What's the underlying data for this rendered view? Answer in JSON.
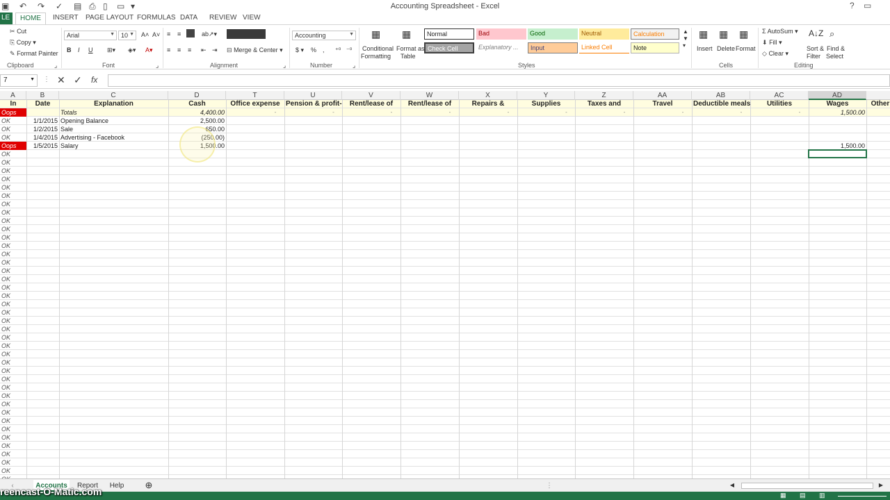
{
  "window": {
    "title": "Accounting Spreadsheet - Excel",
    "help": "?",
    "restore": "▭"
  },
  "tabs": {
    "file": "LE",
    "home": "HOME",
    "insert": "INSERT",
    "page_layout": "PAGE LAYOUT",
    "formulas": "FORMULAS",
    "data": "DATA",
    "review": "REVIEW",
    "view": "VIEW"
  },
  "ribbon": {
    "clipboard": {
      "label": "Clipboard",
      "cut": "Cut",
      "copy": "Copy",
      "format_painter": "Format Painter"
    },
    "font": {
      "label": "Font",
      "name": "Arial",
      "size": "10",
      "bold": "B",
      "italic": "I",
      "underline": "U"
    },
    "alignment": {
      "label": "Alignment",
      "merge": "Merge & Center"
    },
    "number": {
      "label": "Number",
      "format": "Accounting",
      "currency": "$",
      "percent": "%",
      "comma": ","
    },
    "styles": {
      "label": "Styles",
      "conditional": "Conditional",
      "formatting": "Formatting",
      "format_as": "Format as",
      "table": "Table",
      "cells": [
        [
          "Normal",
          "Bad",
          "Good",
          "Neutral",
          "Calculation"
        ],
        [
          "Check Cell",
          "Explanatory ...",
          "Input",
          "Linked Cell",
          "Note"
        ]
      ]
    },
    "cells": {
      "label": "Cells",
      "insert": "Insert",
      "delete": "Delete",
      "format": "Format"
    },
    "editing": {
      "label": "Editing",
      "autosum": "AutoSum",
      "fill": "Fill",
      "clear": "Clear",
      "sort": "Sort &",
      "filter": "Filter",
      "find": "Find &",
      "select": "Select"
    }
  },
  "formula_bar": {
    "name_box": "7",
    "fx": "fx"
  },
  "columns": [
    "A",
    "B",
    "C",
    "D",
    "T",
    "U",
    "V",
    "W",
    "X",
    "Y",
    "Z",
    "AA",
    "AB",
    "AC",
    "AD"
  ],
  "headers": {
    "a": "In",
    "b": "Date",
    "c": "Explanation",
    "d": "Cash",
    "t": "Office expense",
    "u": "Pension & profit-",
    "v": "Rent/lease of",
    "w": "Rent/lease of",
    "x": "Repairs &",
    "y": "Supplies",
    "z": "Taxes and",
    "aa": "Travel",
    "ab": "Deductible meals",
    "ac": "Utilities",
    "ad": "Wages",
    "other": "Other"
  },
  "totals": {
    "status": "Oops",
    "label": "Totals",
    "cash": "4,400.00",
    "wages": "1,500.00",
    "dash": "-"
  },
  "rows": [
    {
      "status": "OK",
      "date": "1/1/2015",
      "explanation": "Opening Balance",
      "cash": "2,500.00",
      "wages": ""
    },
    {
      "status": "OK",
      "date": "1/2/2015",
      "explanation": "Sale",
      "cash": "650.00",
      "wages": ""
    },
    {
      "status": "OK",
      "date": "1/4/2015",
      "explanation": "Advertising - Facebook",
      "cash": "(250.00)",
      "wages": ""
    },
    {
      "status": "Oops",
      "date": "1/5/2015",
      "explanation": "Salary",
      "cash": "1,500.00",
      "wages": "1,500.00"
    }
  ],
  "ok_label": "OK",
  "sheets": {
    "accounts": "Accounts",
    "report": "Report",
    "help": "Help",
    "add": "⊕"
  },
  "watermark": "reencast-O-Matic.com"
}
